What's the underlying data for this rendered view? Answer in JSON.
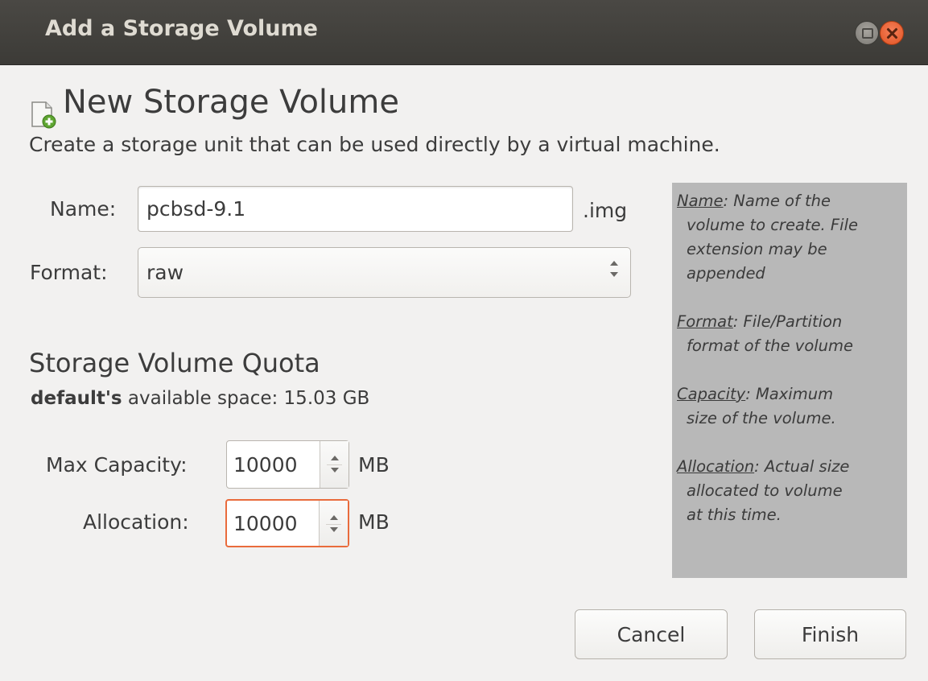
{
  "window": {
    "title": "Add a Storage Volume"
  },
  "header": {
    "title": "New Storage Volume",
    "subtitle": "Create a storage unit that can be used directly by a virtual machine."
  },
  "form": {
    "name_label": "Name:",
    "name_value": "pcbsd-9.1",
    "name_suffix": ".img",
    "format_label": "Format:",
    "format_value": "raw"
  },
  "quota": {
    "title": "Storage Volume Quota",
    "pool_name": "default's",
    "available_text": "available space: 15.03 GB",
    "max_capacity_label": "Max Capacity:",
    "max_capacity_value": "10000",
    "max_capacity_unit": "MB",
    "allocation_label": "Allocation:",
    "allocation_value": "10000",
    "allocation_unit": "MB"
  },
  "help": {
    "name_key": "Name",
    "name_text_1": ": Name of the",
    "name_text_2": "volume to create. File",
    "name_text_3": "extension may be",
    "name_text_4": "appended",
    "format_key": "Format",
    "format_text_1": ": File/Partition",
    "format_text_2": "format of the volume",
    "capacity_key": "Capacity",
    "capacity_text_1": ": Maximum",
    "capacity_text_2": "size of the volume.",
    "allocation_key": "Allocation",
    "allocation_text_1": ": Actual size",
    "allocation_text_2": "allocated to volume",
    "allocation_text_3": "at this time."
  },
  "buttons": {
    "cancel": "Cancel",
    "finish": "Finish"
  },
  "colors": {
    "titlebar": "#3c3b37",
    "close_button": "#e05322",
    "focus_border": "#e96b3c",
    "help_panel": "#b8b8b8"
  }
}
